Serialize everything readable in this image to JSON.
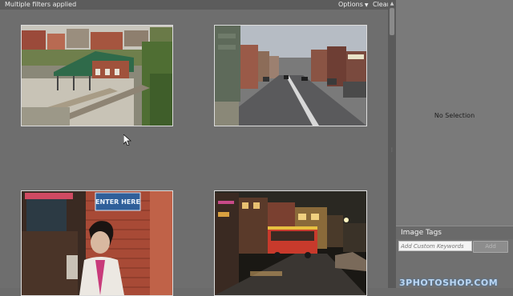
{
  "filter_bar": {
    "status_text": "Multiple filters applied",
    "options_label": "Options",
    "clear_label": "Clear"
  },
  "grid": {
    "thumbnails": [
      {
        "icon": "photo-train-station"
      },
      {
        "icon": "photo-city-street"
      },
      {
        "icon": "photo-elvis-statue",
        "sign_text": "ENTER HERE"
      },
      {
        "icon": "photo-night-trolley"
      }
    ]
  },
  "right_panel": {
    "no_selection_text": "No Selection",
    "image_tags": {
      "title": "Image Tags",
      "keyword_placeholder": "Add Custom Keywords",
      "add_label": "Add"
    }
  },
  "watermark": "3PHOTOSHOP.COM"
}
